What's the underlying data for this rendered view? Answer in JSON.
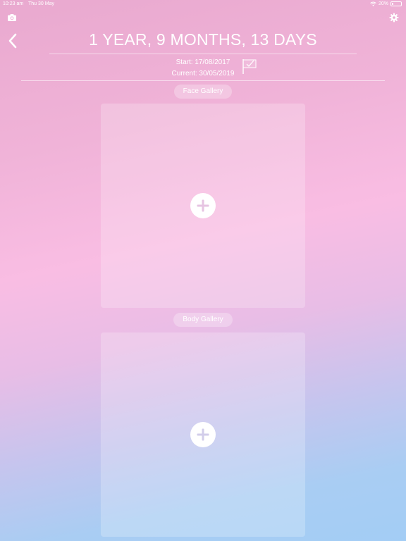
{
  "status_bar": {
    "time": "10:23 am",
    "date": "Thu 30 May",
    "battery": "20%",
    "battery_level": 0.2
  },
  "header": {
    "duration": "1 YEAR, 9 MONTHS, 13 DAYS",
    "start": "Start: 17/08/2017",
    "current": "Current: 30/05/2019"
  },
  "face_gallery": {
    "label": "Face Gallery"
  },
  "body_gallery": {
    "label": "Body Gallery"
  },
  "icons": {
    "camera": "camera-icon",
    "settings": "gear-icon",
    "back": "chevron-left-icon",
    "flag": "finish-flag-icon",
    "add": "plus-icon"
  },
  "colors": {
    "accent_plus": "#e6c4e2",
    "text": "#ffffff"
  }
}
